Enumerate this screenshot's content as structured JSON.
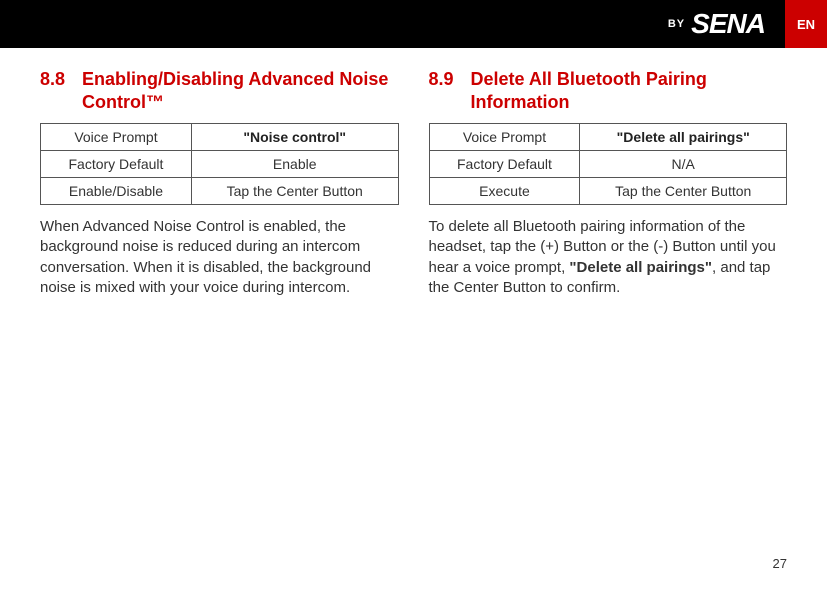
{
  "header": {
    "by": "BY",
    "brand": "SENA",
    "lang": "EN"
  },
  "left": {
    "num": "8.8",
    "title": "Enabling/Disabling Advanced Noise Control™",
    "table": {
      "r1c1": "Voice Prompt",
      "r1c2": "\"Noise control\"",
      "r2c1": "Factory Default",
      "r2c2": "Enable",
      "r3c1": "Enable/Disable",
      "r3c2": "Tap the Center Button"
    },
    "body": "When Advanced Noise Control is enabled, the background noise is reduced during an intercom conversation. When it is disabled, the background noise is mixed with your voice during intercom."
  },
  "right": {
    "num": "8.9",
    "title": "Delete All Bluetooth Pairing Information",
    "table": {
      "r1c1": "Voice Prompt",
      "r1c2": "\"Delete all pairings\"",
      "r2c1": "Factory Default",
      "r2c2": "N/A",
      "r3c1": "Execute",
      "r3c2": "Tap the Center Button"
    },
    "body_pre": "To delete all Bluetooth pairing information of the headset, tap the (+) Button or the (-) Button until you hear a voice prompt, ",
    "body_bold": "\"Delete all pairings\"",
    "body_post": ", and tap the Center Button to confirm."
  },
  "page_number": "27"
}
